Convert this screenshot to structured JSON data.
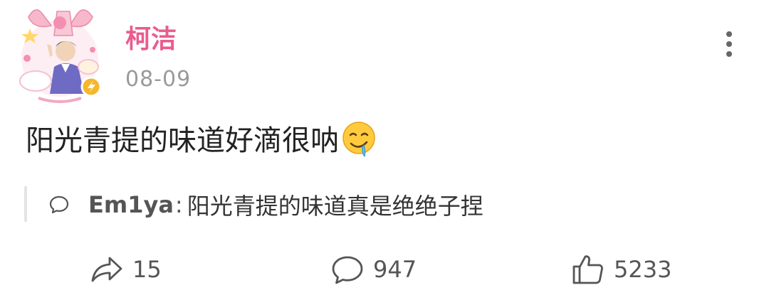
{
  "post": {
    "username": "柯洁",
    "timestamp": "08-09",
    "text": "阳光青提的味道好滴很呐",
    "emoji_icon": "drooling-face-icon"
  },
  "quoted_comment": {
    "author": "Em1ya",
    "separator": ":",
    "text": "阳光青提的味道真是绝绝子捏"
  },
  "stats": {
    "reposts": "15",
    "comments": "947",
    "likes": "5233"
  },
  "colors": {
    "username": "#ea5c8f",
    "muted": "#9a9a9a",
    "icon": "#555555",
    "avatar_frame_pink": "#f7b8cc",
    "verified_badge": "#f6b62d"
  }
}
